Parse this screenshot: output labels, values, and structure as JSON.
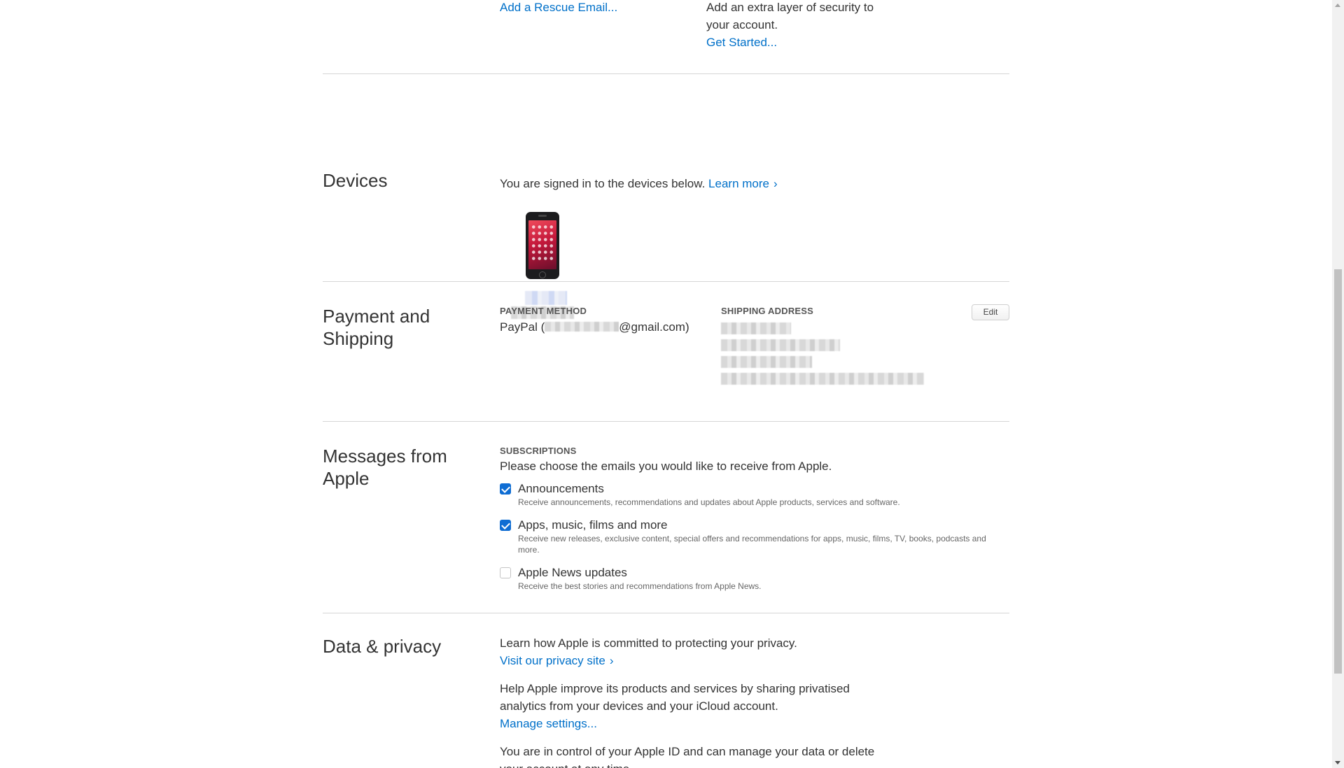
{
  "security": {
    "rescue_email_link": "Add a Rescue Email...",
    "two_factor_text": "Add an extra layer of security to your account.",
    "get_started_link": "Get Started..."
  },
  "devices": {
    "title": "Devices",
    "intro": "You are signed in to the devices below.",
    "learn_more": "Learn more",
    "device_icon": "iphone-icon"
  },
  "payment": {
    "title": "Payment and Shipping",
    "method_label": "PAYMENT METHOD",
    "method_prefix": "PayPal (",
    "method_suffix": "@gmail.com)",
    "shipping_label": "SHIPPING ADDRESS",
    "edit_button": "Edit"
  },
  "messages": {
    "title": "Messages from Apple",
    "subscriptions_label": "SUBSCRIPTIONS",
    "intro": "Please choose the emails you would like to receive from Apple.",
    "options": [
      {
        "title": "Announcements",
        "desc": "Receive announcements, recommendations and updates about Apple products, services and software.",
        "checked": true
      },
      {
        "title": "Apps, music, films and more",
        "desc": "Receive new releases, exclusive content, special offers and recommendations for apps, music, films, TV, books, podcasts and more.",
        "checked": true
      },
      {
        "title": "Apple News updates",
        "desc": "Receive the best stories and recommendations from Apple News.",
        "checked": false
      }
    ]
  },
  "privacy": {
    "title": "Data & privacy",
    "intro": "Learn how Apple is committed to protecting your privacy.",
    "privacy_link": "Visit our privacy site",
    "analytics_text": "Help Apple improve its products and services by sharing privatised analytics from your devices and your iCloud account.",
    "manage_link": "Manage settings...",
    "control_text": "You are in control of your Apple ID and can manage your data or delete your account at any time."
  },
  "colors": {
    "link": "#0070c9",
    "checkbox_checked": "#0f6dd3",
    "divider": "#d6d6d6"
  }
}
